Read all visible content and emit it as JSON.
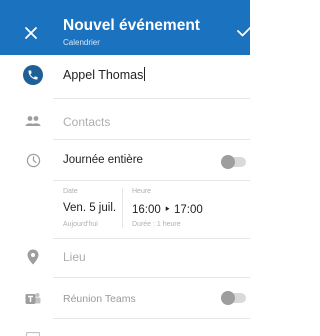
{
  "header": {
    "title": "Nouvel événement",
    "subtitle": "Calendrier",
    "close_icon": "close-icon",
    "confirm_icon": "check-icon"
  },
  "form": {
    "title_value": "Appel Thomas",
    "contacts_placeholder": "Contacts",
    "all_day_label": "Journée entière",
    "all_day_on": false,
    "date_label": "Date",
    "date_value": "Ven. 5 juil.",
    "date_hint": "Aujourd'hui",
    "time_label": "Heure",
    "time_value": "16:00 ‣ 17:00",
    "duration_hint": "Durée : 1 heure",
    "location_placeholder": "Lieu",
    "teams_label": "Réunion Teams",
    "teams_on": false
  },
  "colors": {
    "header_bg": "#1b72bf",
    "accent_dark": "#1e5f97",
    "icon_gray": "#9e9e9e"
  }
}
